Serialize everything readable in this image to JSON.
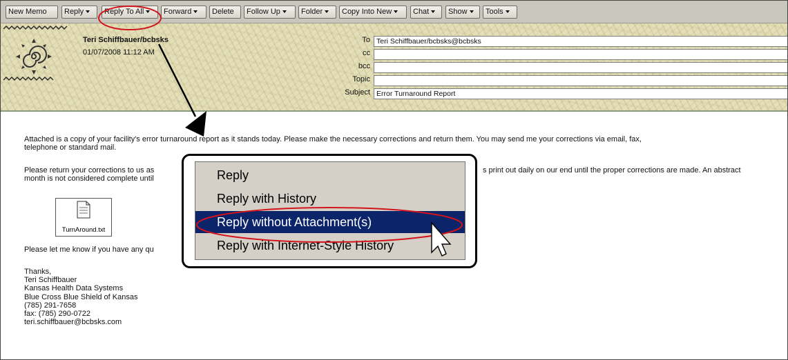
{
  "toolbar": {
    "buttons": [
      {
        "label": "New Memo",
        "dropdown": false
      },
      {
        "label": "Reply",
        "dropdown": true
      },
      {
        "label": "Reply To All",
        "dropdown": true
      },
      {
        "label": "Forward",
        "dropdown": true
      },
      {
        "label": "Delete",
        "dropdown": false
      },
      {
        "label": "Follow Up",
        "dropdown": true
      },
      {
        "label": "Folder",
        "dropdown": true
      },
      {
        "label": "Copy Into New",
        "dropdown": true
      },
      {
        "label": "Chat",
        "dropdown": true
      },
      {
        "label": "Show",
        "dropdown": true
      },
      {
        "label": "Tools",
        "dropdown": true
      }
    ]
  },
  "header": {
    "sender": "Teri Schiffbauer/bcbsks",
    "date": "01/07/2008 11:12 AM",
    "fields": [
      {
        "label": "To",
        "value": "Teri Schiffbauer/bcbsks@bcbsks"
      },
      {
        "label": "cc",
        "value": ""
      },
      {
        "label": "bcc",
        "value": ""
      },
      {
        "label": "Topic",
        "value": ""
      },
      {
        "label": "Subject",
        "value": "Error Turnaround Report"
      }
    ]
  },
  "message": {
    "para1_line1": "Attached is a copy of your facility's error turnaround report as it stands today.  Please make the necessary corrections and return them.  You may send me your corrections via email, fax,",
    "para1_line2": "telephone or standard mail.",
    "para2_line1_left": "Please return your corrections to us as",
    "para2_line2_left": "month is not considered complete until",
    "para2_line1_right": "s print out daily on our end until the proper corrections are made.  An abstract",
    "attachment_name": "TurnAround.txt",
    "para3_left": "Please let me know if you have any qu",
    "signature": [
      "Thanks,",
      "Teri Schiffbauer",
      "Kansas Health Data Systems",
      "Blue Cross Blue Shield of Kansas",
      "(785) 291-7658",
      "fax: (785) 290-0722",
      "teri.schiffbauer@bcbsks.com"
    ]
  },
  "reply_menu": {
    "items": [
      {
        "label": "Reply",
        "mnemonic": "R",
        "highlighted": false
      },
      {
        "label": "Reply with History",
        "mnemonic": "p",
        "highlighted": false
      },
      {
        "label": "Reply without Attachment(s)",
        "mnemonic": "p",
        "highlighted": true
      },
      {
        "label": "Reply with Internet-Style History",
        "mnemonic": "",
        "highlighted": false
      }
    ]
  },
  "colors": {
    "menu_highlight": "#0b246a",
    "annotation_red": "#d2141c",
    "header_bg": "#e4dfb8"
  }
}
